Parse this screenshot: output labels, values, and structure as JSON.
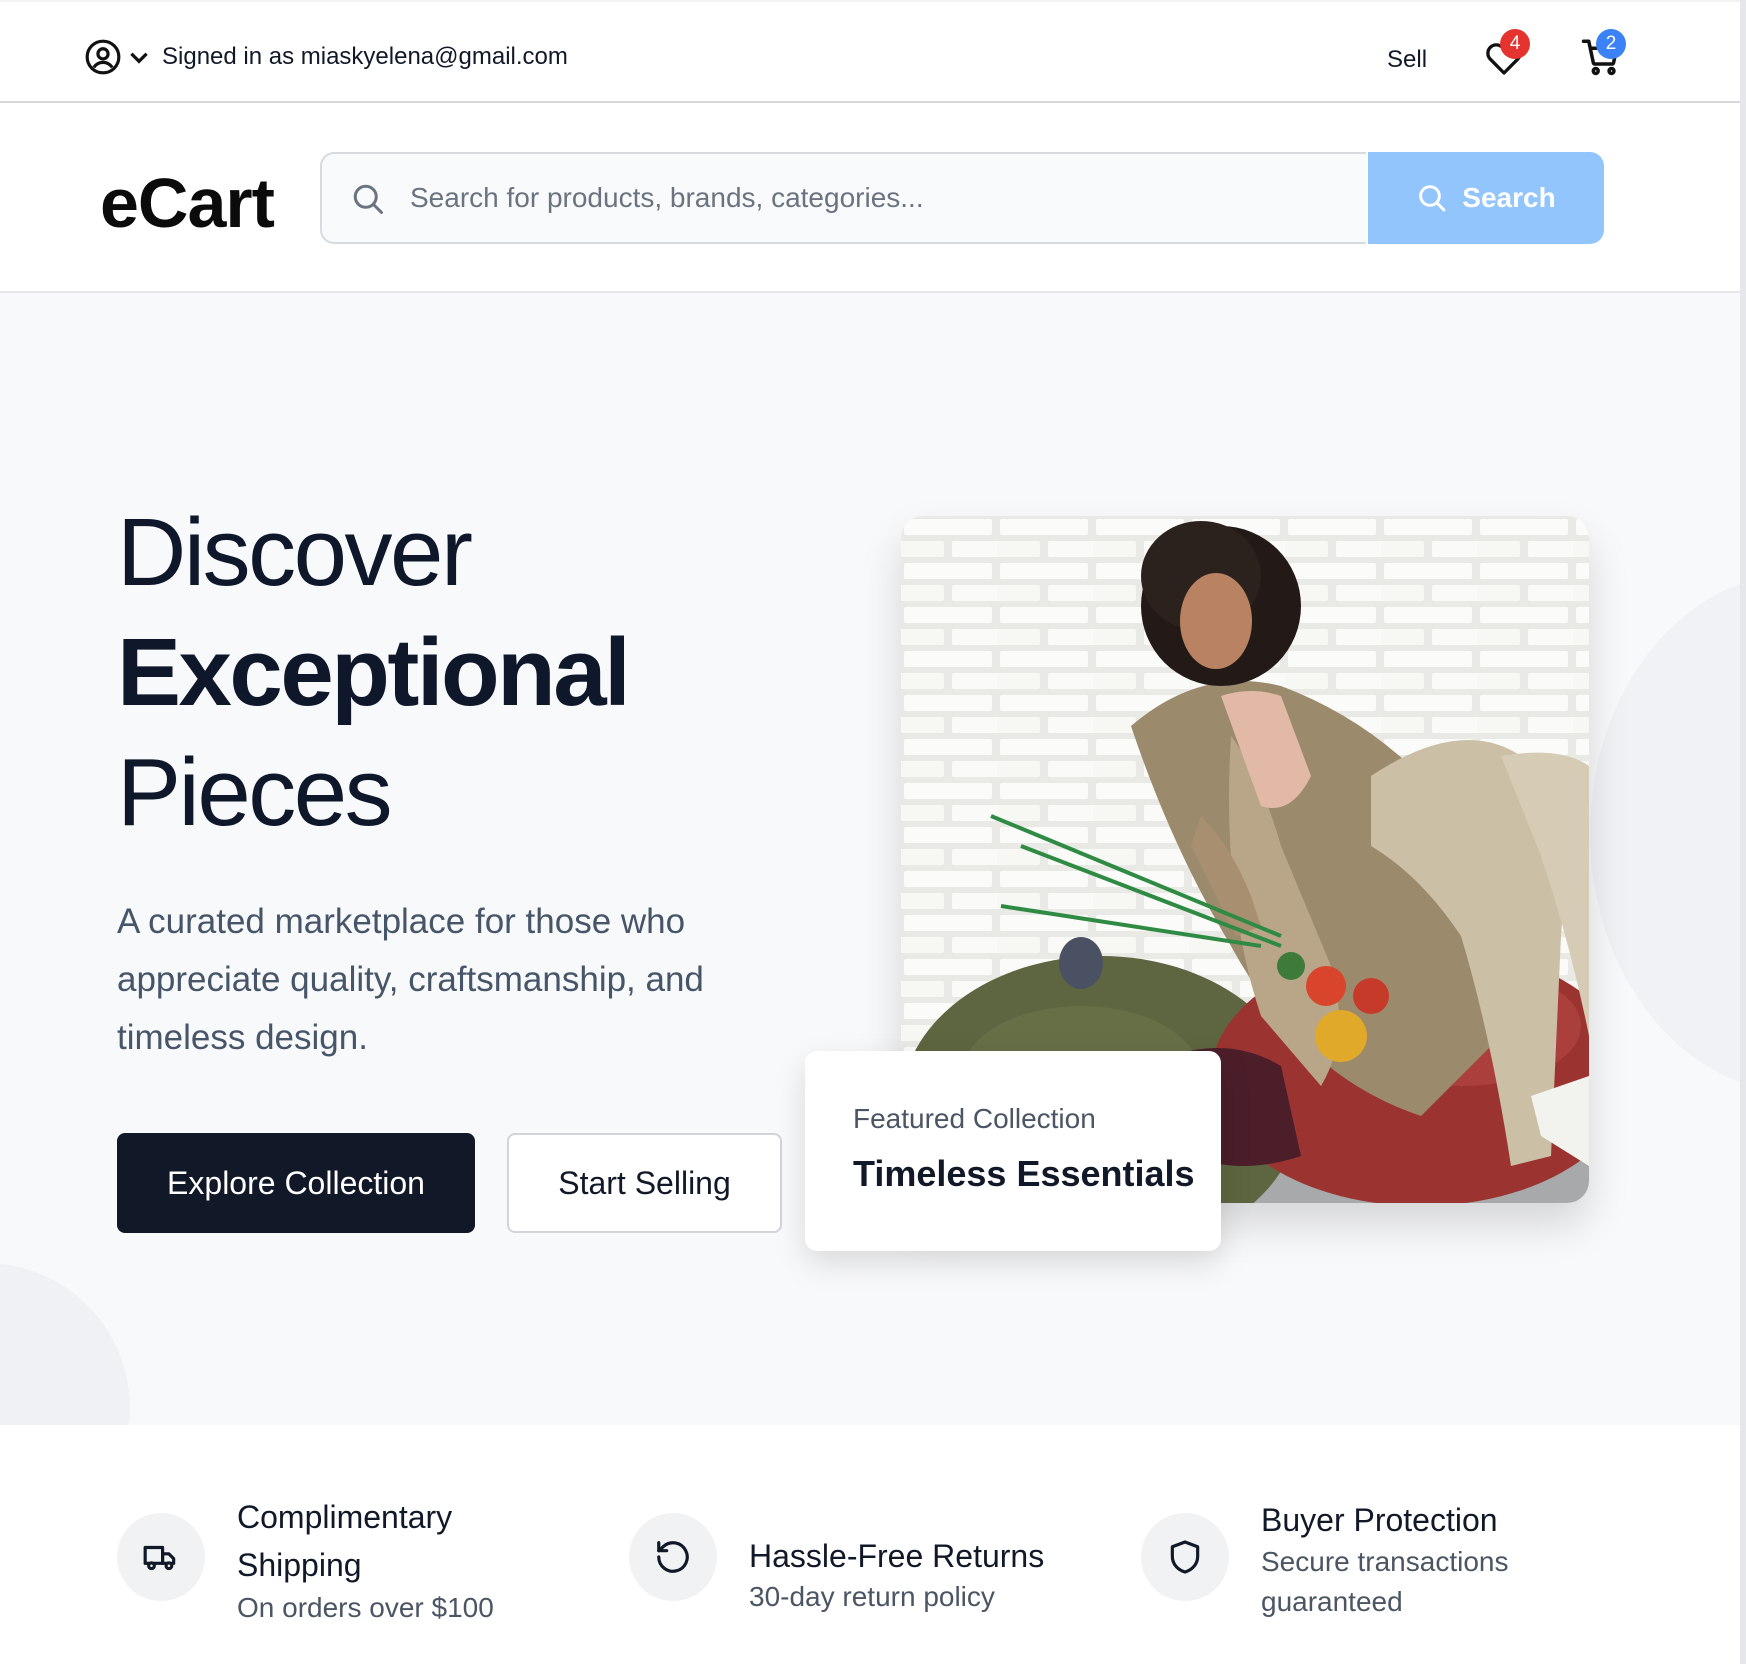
{
  "topbar": {
    "signed_in_text": "Signed in as miaskyelena@gmail.com",
    "sell_label": "Sell",
    "wishlist_count": "4",
    "cart_count": "2"
  },
  "header": {
    "logo": "eCart",
    "search_placeholder": "Search for products, brands, categories...",
    "search_button_label": "Search"
  },
  "hero": {
    "title_line1": "Discover",
    "title_line2": "Exceptional",
    "title_line3": "Pieces",
    "subtitle": "A curated marketplace for those who appreciate quality, craftsmanship, and timeless design.",
    "primary_button": "Explore Collection",
    "secondary_button": "Start Selling",
    "featured_kicker": "Featured Collection",
    "featured_name": "Timeless Essentials"
  },
  "features": [
    {
      "title": "Complimentary Shipping",
      "subtitle": "On orders over $100",
      "icon": "truck-icon"
    },
    {
      "title": "Hassle-Free Returns",
      "subtitle": "30-day return policy",
      "icon": "rotate-ccw-icon"
    },
    {
      "title": "Buyer Protection",
      "subtitle": "Secure transactions guaranteed",
      "icon": "shield-icon"
    }
  ],
  "colors": {
    "accent_button": "#93c5fd",
    "primary_dark": "#111827",
    "badge_red": "#e5342f",
    "badge_blue": "#3b82f6",
    "hero_bg": "#f8f9fb"
  }
}
